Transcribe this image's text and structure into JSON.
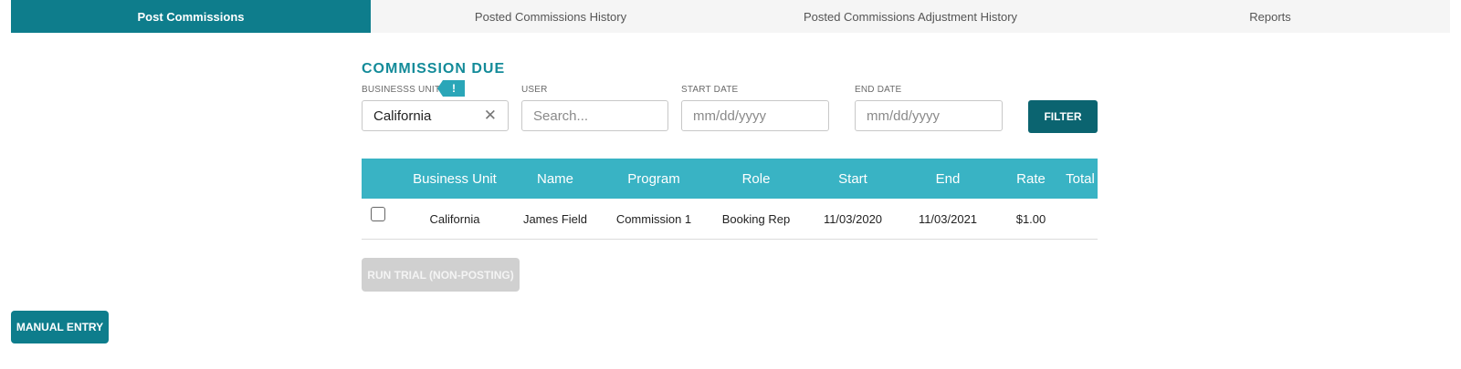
{
  "tabs": [
    {
      "label": "Post Commissions",
      "active": true
    },
    {
      "label": "Posted Commissions History",
      "active": false
    },
    {
      "label": "Posted Commissions Adjustment History",
      "active": false
    },
    {
      "label": "Reports",
      "active": false
    }
  ],
  "section_title": "COMMISSION DUE",
  "filters": {
    "business_unit": {
      "label": "BUSINESSS UNIT",
      "value": "California",
      "badge": "!",
      "clear_icon": "close-icon"
    },
    "user": {
      "label": "USER",
      "placeholder": "Search..."
    },
    "start_date": {
      "label": "START DATE",
      "placeholder": "mm/dd/yyyy"
    },
    "end_date": {
      "label": "END DATE",
      "placeholder": "mm/dd/yyyy"
    },
    "filter_button": "FILTER"
  },
  "table": {
    "headers": [
      "Business Unit",
      "Name",
      "Program",
      "Role",
      "Start",
      "End",
      "Rate",
      "Total"
    ],
    "rows": [
      [
        "California",
        "James Field",
        "Commission 1",
        "Booking Rep",
        "11/03/2020",
        "11/03/2021",
        "$1.00",
        ""
      ]
    ]
  },
  "run_trial_button": "RUN TRIAL (NON-POSTING)",
  "manual_entry_button": "MANUAL ENTRY",
  "colors": {
    "active_tab": "#0e7d8c",
    "accent_title": "#138b99",
    "table_header": "#39b3c4",
    "filter_button": "#0b6470",
    "disabled_button": "#d0d0d0"
  }
}
